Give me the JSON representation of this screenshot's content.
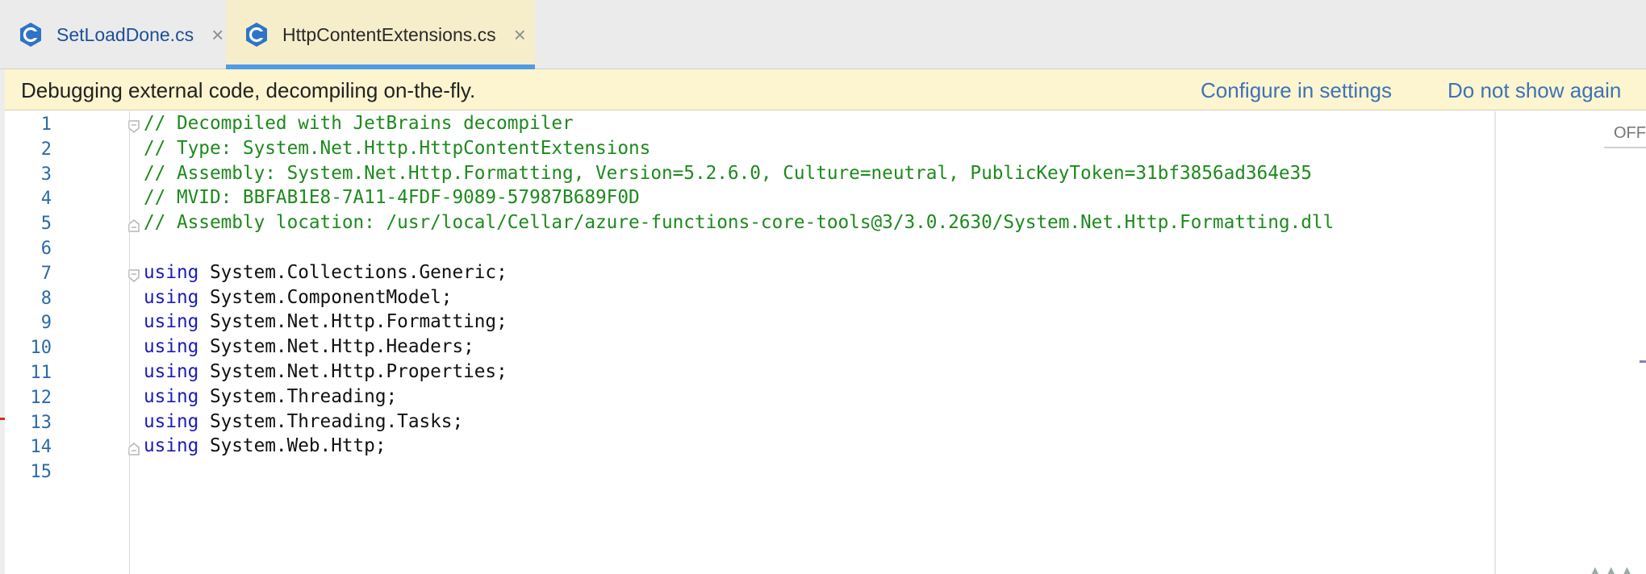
{
  "tabs": [
    {
      "label": "SetLoadDone.cs",
      "close": "×",
      "icon": "csharp-file-icon"
    },
    {
      "label": "HttpContentExtensions.cs",
      "close": "×",
      "icon": "csharp-file-icon",
      "active": true
    }
  ],
  "banner": {
    "text": "Debugging external code, decompiling on-the-fly.",
    "configure_link": "Configure in settings",
    "dismiss_link": "Do not show again"
  },
  "editor": {
    "lines": [
      {
        "n": "1",
        "parts": [
          {
            "t": "// Decompiled with JetBrains decompiler",
            "c": "comment"
          }
        ],
        "fold": "open"
      },
      {
        "n": "2",
        "parts": [
          {
            "t": "// Type: System.Net.Http.HttpContentExtensions",
            "c": "comment"
          }
        ]
      },
      {
        "n": "3",
        "parts": [
          {
            "t": "// Assembly: System.Net.Http.Formatting, Version=5.2.6.0, Culture=neutral, PublicKeyToken=31bf3856ad364e35",
            "c": "comment"
          }
        ]
      },
      {
        "n": "4",
        "parts": [
          {
            "t": "// MVID: BBFAB1E8-7A11-4FDF-9089-57987B689F0D",
            "c": "comment"
          }
        ]
      },
      {
        "n": "5",
        "parts": [
          {
            "t": "// Assembly location: /usr/local/Cellar/azure-functions-core-tools@3/3.0.2630/System.Net.Http.Formatting.dll",
            "c": "comment"
          }
        ],
        "fold": "close"
      },
      {
        "n": "6",
        "parts": []
      },
      {
        "n": "7",
        "parts": [
          {
            "t": "using",
            "c": "kw"
          },
          {
            "t": " System.Collections.Generic;",
            "c": "plain"
          }
        ],
        "fold": "open"
      },
      {
        "n": "8",
        "parts": [
          {
            "t": "using",
            "c": "kw"
          },
          {
            "t": " System.ComponentModel;",
            "c": "plain"
          }
        ]
      },
      {
        "n": "9",
        "parts": [
          {
            "t": "using",
            "c": "kw"
          },
          {
            "t": " System.Net.Http.Formatting;",
            "c": "plain"
          }
        ]
      },
      {
        "n": "10",
        "parts": [
          {
            "t": "using",
            "c": "kw"
          },
          {
            "t": " System.Net.Http.Headers;",
            "c": "plain"
          }
        ]
      },
      {
        "n": "11",
        "parts": [
          {
            "t": "using",
            "c": "kw"
          },
          {
            "t": " System.Net.Http.Properties;",
            "c": "plain"
          }
        ]
      },
      {
        "n": "12",
        "parts": [
          {
            "t": "using",
            "c": "kw"
          },
          {
            "t": " System.Threading;",
            "c": "plain"
          }
        ]
      },
      {
        "n": "13",
        "parts": [
          {
            "t": "using",
            "c": "kw"
          },
          {
            "t": " System.Threading.Tasks;",
            "c": "plain"
          }
        ]
      },
      {
        "n": "14",
        "parts": [
          {
            "t": "using",
            "c": "kw"
          },
          {
            "t": " System.Web.Http;",
            "c": "plain"
          }
        ],
        "fold": "close"
      },
      {
        "n": "15",
        "parts": []
      }
    ]
  },
  "right_panel": {
    "off_label": "OFF",
    "dots": "▲▲▲"
  },
  "colors": {
    "comment": "#1d8a1d",
    "keyword": "#1c1cb8",
    "line_number": "#2b6aa8",
    "banner_bg": "#fcf5cf",
    "link": "#3d73b6",
    "active_tab_bg": "#f6eecb",
    "active_tab_bar": "#4f9be6"
  }
}
